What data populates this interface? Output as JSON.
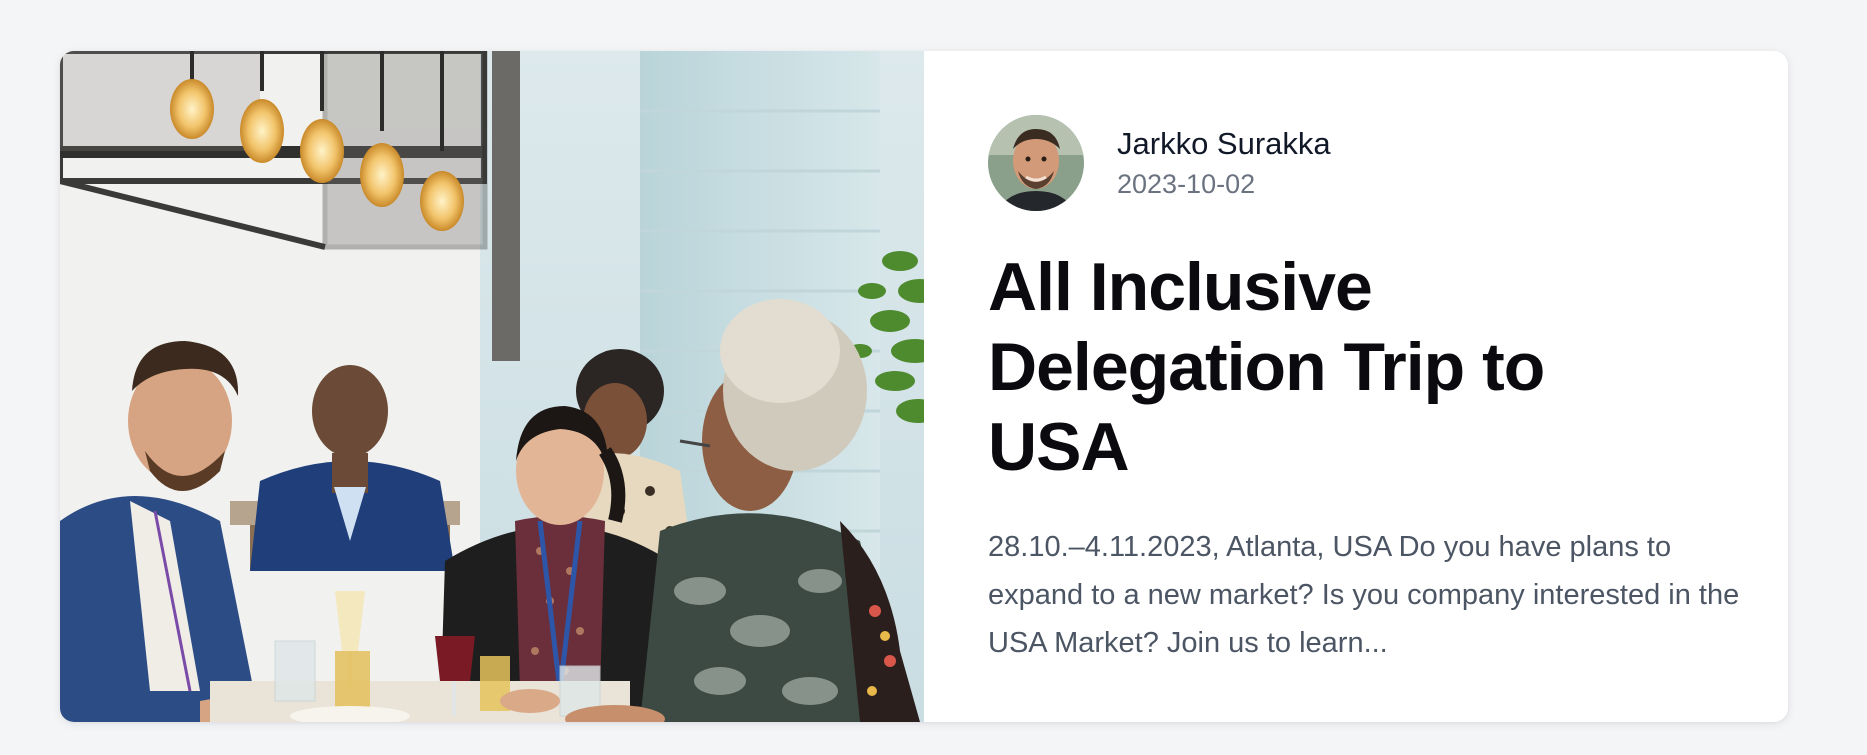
{
  "post": {
    "author_name": "Jarkko Surakka",
    "date": "2023-10-02",
    "title": "All Inclusive Delegation Trip to USA",
    "excerpt": "28.10.–4.11.2023, Atlanta, USA Do you have plans to expand to a new market? Is you company interested in the USA Market? Join us to learn..."
  },
  "colors": {
    "page_background": "#f4f5f7",
    "card_background": "#ffffff",
    "title": "#0b0b0f",
    "body_text": "#4b5563",
    "meta_text": "#6b7280"
  },
  "images": {
    "cover": "people-dining-photo",
    "avatar": "author-portrait"
  }
}
